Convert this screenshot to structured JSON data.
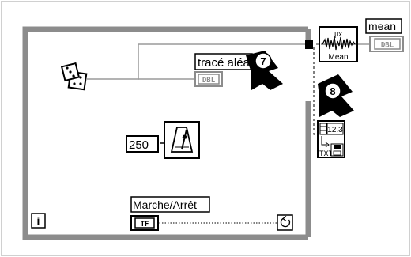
{
  "diagram": {
    "indicator_label": "tracé aléatoire",
    "indicator_type": "DBL",
    "mean_label": "mean",
    "mean_type": "DBL",
    "wait_value": "250",
    "stop_label": "Marche/Arrêt",
    "stop_type": "TF",
    "loop_iteration": "i",
    "mean_vi_caption": "Mean",
    "mean_vi_symbol": "μx",
    "write_vi_format": "12.3",
    "write_vi_caption": "TXT",
    "callout_7": "7",
    "callout_8": "8"
  },
  "colors": {
    "frame": "#8c8c8c",
    "wire": "#9a9a9a",
    "ink": "#000000",
    "background": "#ffffff"
  }
}
